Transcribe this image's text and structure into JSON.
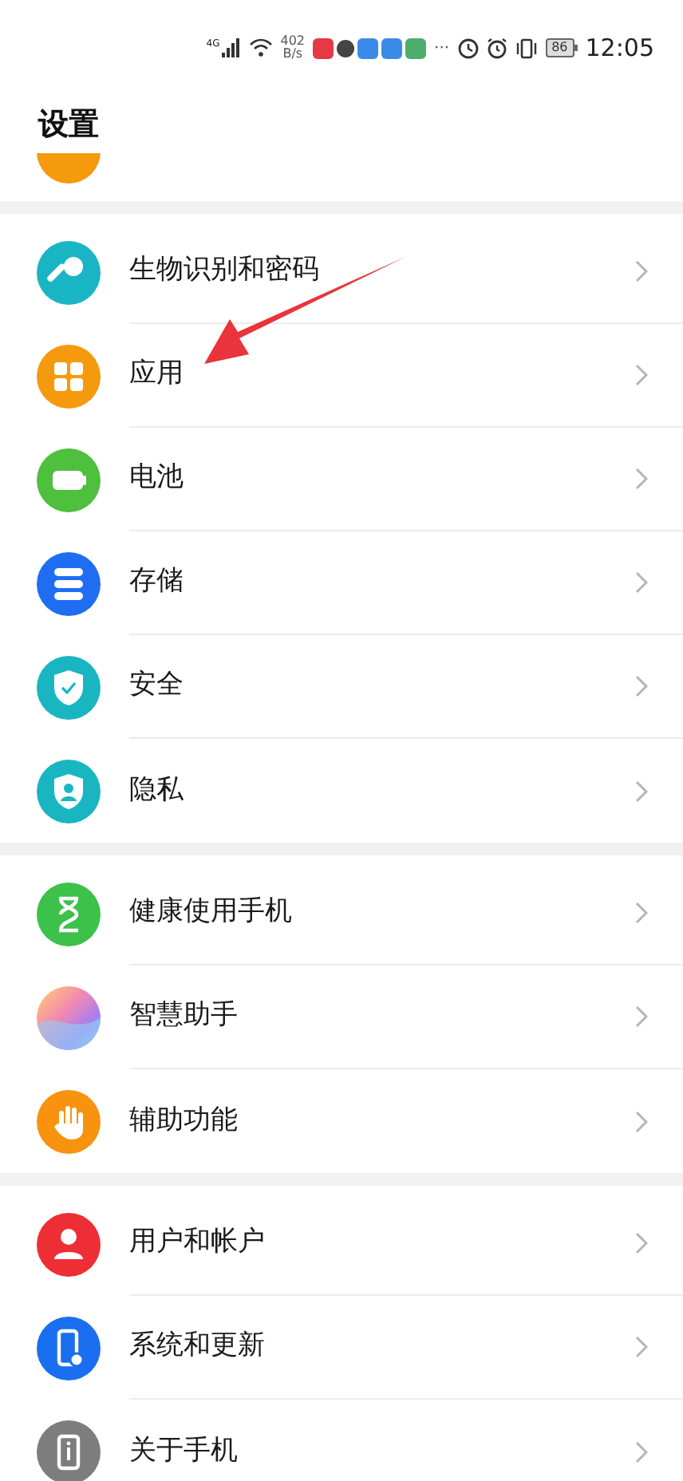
{
  "status_bar": {
    "network": "4G",
    "speed_value": "402",
    "speed_unit": "B/s",
    "more": "···",
    "battery": "86",
    "time": "12:05"
  },
  "title": "设置",
  "sections": [
    [
      {
        "kind": "key",
        "label": "生物识别和密码"
      },
      {
        "kind": "apps",
        "label": "应用"
      },
      {
        "kind": "battery",
        "label": "电池"
      },
      {
        "kind": "storage",
        "label": "存储"
      },
      {
        "kind": "shield",
        "label": "安全"
      },
      {
        "kind": "privacy",
        "label": "隐私"
      }
    ],
    [
      {
        "kind": "hourglass",
        "label": "健康使用手机"
      },
      {
        "kind": "assistant",
        "label": "智慧助手"
      },
      {
        "kind": "hand",
        "label": "辅助功能"
      }
    ],
    [
      {
        "kind": "user",
        "label": "用户和帐户"
      },
      {
        "kind": "system",
        "label": "系统和更新"
      },
      {
        "kind": "about",
        "label": "关于手机"
      }
    ]
  ]
}
